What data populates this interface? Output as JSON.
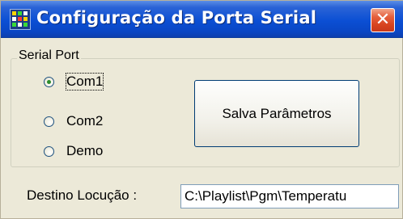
{
  "window": {
    "title": "Configuração da Porta Serial",
    "close_glyph": "✕",
    "icon": "app-grid-icon"
  },
  "serial_port": {
    "group_label": "Serial Port",
    "options": [
      {
        "label": "Com1",
        "checked": true,
        "focused": true
      },
      {
        "label": "Com2",
        "checked": false,
        "focused": false
      },
      {
        "label": "Demo",
        "checked": false,
        "focused": false
      }
    ]
  },
  "save_button": {
    "label": "Salva Parâmetros"
  },
  "destination": {
    "label": "Destino Locução :",
    "value": "C:\\Playlist\\Pgm\\Temperatu"
  },
  "colors": {
    "titlebar": "#0b4fd4",
    "window_bg": "#ece9d8",
    "close_button": "#d8441f"
  }
}
